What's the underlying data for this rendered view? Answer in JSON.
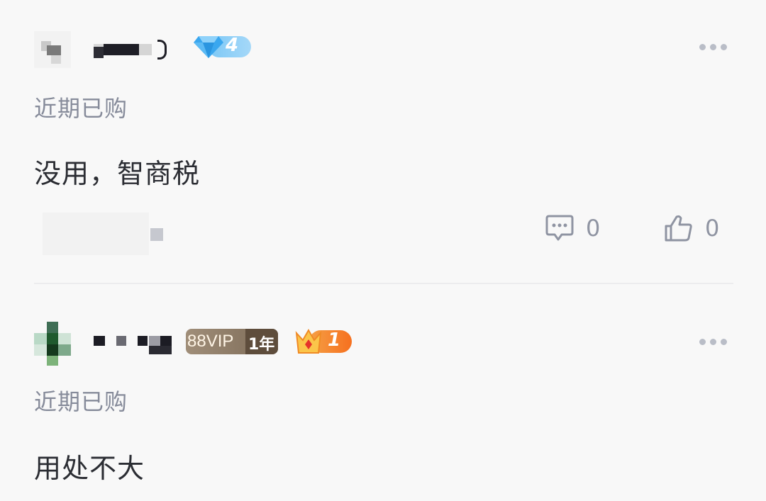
{
  "reviews": [
    {
      "user_level_badge": "4",
      "purchase_label": "近期已购",
      "comment": "没用，智商税",
      "reply_count": "0",
      "like_count": "0",
      "icons": {
        "badge": "diamond-icon",
        "reply": "comment-bubble-icon",
        "like": "thumbs-up-icon",
        "more": "more-dots-icon"
      }
    },
    {
      "vip_label": "88VIP",
      "vip_years": "1年",
      "crown_level": "1",
      "purchase_label": "近期已购",
      "comment": "用处不大",
      "icons": {
        "badge": "crown-icon",
        "more": "more-dots-icon"
      }
    }
  ],
  "colors": {
    "background": "#f8f8f8",
    "label_gray": "#868b9a",
    "text_dark": "#2b2d33",
    "diamond_blue": "#4fb3f3",
    "vip_brown": "#8a7866",
    "crown_orange": "#f6701f"
  }
}
